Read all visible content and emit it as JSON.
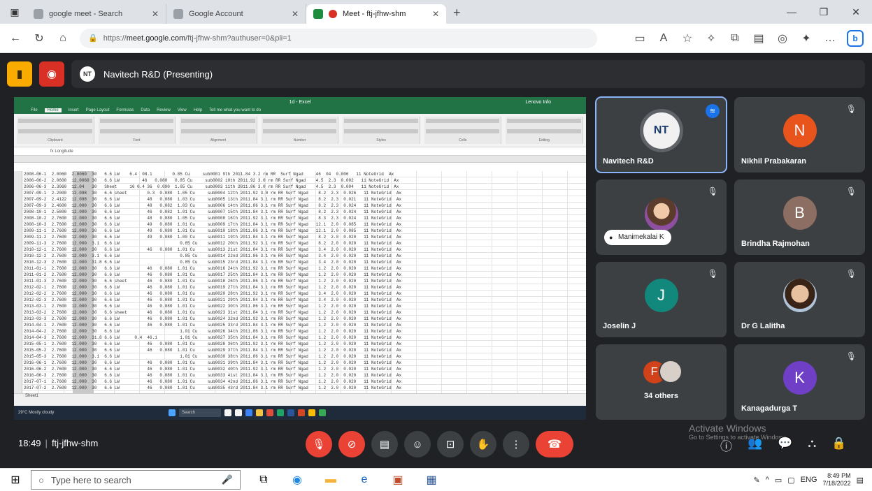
{
  "browser": {
    "tabs": [
      {
        "title": "google meet - Search",
        "active": false
      },
      {
        "title": "Google Account",
        "active": false
      },
      {
        "title": "Meet - ftj-jfhw-shm",
        "active": true
      }
    ],
    "url_prefix": "https://",
    "url_host": "meet.google.com",
    "url_path": "/ftj-jfhw-shm?authuser=0&pli=1",
    "profile_letter": "b"
  },
  "meet": {
    "presenting_label": "Navitech R&D (Presenting)",
    "presenter_initials": "NT",
    "meeting_time": "18:49",
    "meeting_code": "ftj-jfhw-shm",
    "activate_title": "Activate Windows",
    "activate_sub": "Go to Settings to activate Windows."
  },
  "spreadsheet": {
    "title": "1d - Excel",
    "account": "Lenovo Info",
    "menu": [
      "File",
      "Home",
      "Insert",
      "Page Layout",
      "Formulas",
      "Data",
      "Review",
      "View",
      "Help",
      "Tell me what you want to do"
    ],
    "ribbon_groups": [
      "Clipboard",
      "Font",
      "Alignment",
      "Number",
      "Styles",
      "Cells",
      "Editing"
    ],
    "formula": "fx  Longitude",
    "rows": [
      "2008-06-1  2.0060  2.0060  30   6.6 LW    6.4  08.1        0.85 Cu     sub0001 9th 2011.84 3.2 rm RR  Surf Ngad     46  04  0.006   11 NoteGrid  Ax",
      "2006-06-2  2.0600  12.0060 30   6.6 LW         46   0.080   0.85 Cu     sub0002 10th 2011.92 3.0 rm RR Surf Ngad    4.5  2.3  0.002   11 NoteGrid  Ax",
      "2006-06-3  2.3060  12.04   30   Sheet     16 0.4 36  0.090  1.05 Cu     sub0003 11th 2011.86 3.0 rm RR Surf Ngad    4.5  2.3  0.004   11 NoteGrid  Ax",
      "2007-09-1  2.2000  12.098  30   6.6 sheet        0.3  0.080  1.05 Cu     sub0004 12th 2011.92 3.0 rm RR Surf Ngad    8.2  2.3  0.026   11 NoteGrid  Ax",
      "2007-09-2  2.4122  12.098  30   6.6 LW           48   0.080  1.03 Cu     sub0005 13th 2011.84 3.1 rm RR Surf Ngad    8.2  2.3  0.021   11 NoteGrid  Ax",
      "2007-09-3  2.4600  12.000  30   6.6 LW           48   0.082  1.03 Cu     sub0006 14th 2011.86 3.1 rm RR Surf Ngad    8.2  2.3  0.024   11 NoteGrid  Ax",
      "2008-10-1  2.5800  12.000  30   6.6 LW           46   0.082  1.01 Cu     sub0007 15th 2011.84 3.1 rm RR Surf Ngad    8.2  2.3  0.024   11 NoteGrid  Ax",
      "2008-10-2  2.7600  12.000  30   6.6 LW           48   0.080  1.05 Cu     sub0008 16th 2011.92 3.1 rm RR Surf Ngad    8.3  2.3  0.024   11 NoteGrid  Ax",
      "2008-10-3  2.7600  12.000  30   6.6 LW           49   0.080  1.01 Cu     sub0009 17th 2011.84 3.1 rm RR Surf Ngad   12.1  2.0  0.085   11 NoteGrid  Ax",
      "2009-11-1  2.7600  12.000  30   6.6 LW           49   0.080  1.01 Cu     sub0010 18th 2011.86 3.1 rm RR Surf Ngad   12.1  2.0  0.085   11 NoteGrid  Ax",
      "2009-11-2  2.7600  12.000  30   6.6 LW           49   0.080  1.00 Cu     sub0011 19th 2011.84 3.1 rm RR Surf Ngad    8.2  2.0  0.020   11 NoteGrid  Ax",
      "2009-11-3  2.7600  12.000  3.1  6.6 LW                        0.85 Cu    sub0012 20th 2011.92 3.1 rm RR Surf Ngad    8.2  2.0  0.020   11 NoteGrid  Ax",
      "2010-12-1  2.7600  12.000  30   6.6 LW           46   0.080  1.01 Cu     sub0013 21st 2011.84 3.1 rm RR Surf Ngad    3.4  2.0  0.020   11 NoteGrid  Ax",
      "2010-12-2  2.7600  12.000  3.1  6.6 LW                        0.85 Cu    sub0014 22nd 2011.86 3.1 rm RR Surf Ngad    3.4  2.0  0.020   11 NoteGrid  Ax",
      "2010-12-3  2.7600  12.000  31.8 6.6 LW                        0.85 Cu    sub0015 23rd 2011.84 3.1 rm RR Surf Ngad    3.4  2.0  0.020   11 NoteGrid  Ax",
      "2011-01-1  2.7600  12.000  30   6.6 LW           46   0.080  1.01 Cu     sub0016 24th 2011.92 3.1 rm RR Surf Ngad    1.2  2.0  0.020   11 NoteGrid  Ax",
      "2011-01-2  2.7600  12.000  30   6.6 LW           46   0.080  1.01 Cu     sub0017 25th 2011.84 3.1 rm RR Surf Ngad    1.2  2.0  0.020   11 NoteGrid  Ax",
      "2011-01-3  2.7600  12.000  30   6.6 sheet        46   0.080  1.01 Cu     sub0018 26th 2011.86 3.1 rm RR Surf Ngad    1.2  2.0  0.020   11 NoteGrid  Ax",
      "2012-02-1  2.7600  12.000  30   6.6 LW           46   0.080  1.01 Cu     sub0019 27th 2011.84 3.1 rm RR Surf Ngad    1.2  2.0  0.020   11 NoteGrid  Ax",
      "2012-02-2  2.7600  12.000  30   6.6 LW           46   0.080  1.01 Cu     sub0020 28th 2011.92 3.1 rm RR Surf Ngad    3.4  2.0  0.020   11 NoteGrid  Ax",
      "2012-02-3  2.7600  12.000  30   6.6 LW           46   0.080  1.01 Cu     sub0021 29th 2011.84 3.1 rm RR Surf Ngad    3.4  2.0  0.020   11 NoteGrid  Ax",
      "2013-03-1  2.7600  12.000  30   6.6 LW           46   0.080  1.01 Cu     sub0022 30th 2011.86 3.1 rm RR Surf Ngad    1.2  2.0  0.020   11 NoteGrid  Ax",
      "2013-03-2  2.7600  12.000  30   6.6 sheet        46   0.080  1.01 Cu     sub0023 31st 2011.84 3.1 rm RR Surf Ngad    1.2  2.0  0.020   11 NoteGrid  Ax",
      "2013-03-3  2.7600  12.000  30   6.6 LW           46   0.080  1.01 Cu     sub0024 32nd 2011.92 3.1 rm RR Surf Ngad    1.2  2.0  0.020   11 NoteGrid  Ax",
      "2014-04-1  2.7600  12.000  30   6.6 LW           46   0.080  1.01 Cu     sub0025 33rd 2011.84 3.1 rm RR Surf Ngad    1.2  2.0  0.020   11 NoteGrid  Ax",
      "2014-04-2  2.7600  12.000  30   6.6 LW                        1.01 Cu    sub0026 34th 2011.86 3.1 rm RR Surf Ngad    1.2  2.0  0.020   11 NoteGrid  Ax",
      "2014-04-3  2.7600  12.000  31.8 6.6 LW      0.4  46.1         1.01 Cu    sub0027 35th 2011.84 3.1 rm RR Surf Ngad    1.2  2.0  0.020   11 NoteGrid  Ax",
      "2015-05-1  2.7600  12.000  30   6.6 LW           46   0.080  1.01 Cu     sub0028 36th 2011.92 3.1 rm RR Surf Ngad    1.2  2.0  0.020   11 NoteGrid  Ax",
      "2015-05-2  2.7600  12.000  30   6.6 LW           46   0.080  1.01 Cu     sub0029 37th 2011.84 3.1 rm RR Surf Ngad    1.2  2.0  0.020   11 NoteGrid  Ax",
      "2015-05-3  2.7600  12.000  3.1  6.6 LW                        1.01 Cu    sub0030 38th 2011.86 3.1 rm RR Surf Ngad    1.2  2.0  0.020   11 NoteGrid  Ax",
      "2016-06-1  2.7600  12.000  30   6.6 LW           46   0.080  1.01 Cu     sub0031 39th 2011.84 3.1 rm RR Surf Ngad    1.2  2.0  0.020   11 NoteGrid  Ax",
      "2016-06-2  2.7600  12.000  30   6.6 LW           46   0.080  1.01 Cu     sub0032 40th 2011.92 3.1 rm RR Surf Ngad    1.2  2.0  0.020   11 NoteGrid  Ax",
      "2016-06-3  2.7600  12.000  30   6.6 LW           46   0.080  1.01 Cu     sub0033 41st 2011.84 3.1 rm RR Surf Ngad    1.2  2.0  0.020   11 NoteGrid  Ax",
      "2017-07-1  2.7600  12.000  30   6.6 LW           46   0.080  1.01 Cu     sub0034 42nd 2011.86 3.1 rm RR Surf Ngad    1.2  2.0  0.020   11 NoteGrid  Ax",
      "2017-07-2  2.7600  12.000  30   6.6 LW           46   0.080  1.01 Cu     sub0035 43rd 2011.84 3.1 rm RR Surf Ngad    1.2  2.0  0.020   11 NoteGrid  Ax"
    ],
    "sheet_tab": "Sheet1",
    "taskbar_weather": "29°C  Mostly cloudy",
    "taskbar_search": "Search"
  },
  "participants": [
    {
      "name": "Navitech R&D",
      "initial": "NT",
      "color": "#f1f1f1",
      "speaking": true
    },
    {
      "name": "Nikhil Prabakaran",
      "initial": "N",
      "color": "#e8541c",
      "speaking": false
    },
    {
      "name": "Manimekalai K",
      "initial": "",
      "color": "",
      "speaking": false
    },
    {
      "name": "Brindha Rajmohan",
      "initial": "B",
      "color": "#8d6e63",
      "speaking": false
    },
    {
      "name": "Joselin J",
      "initial": "J",
      "color": "#12877b",
      "speaking": false
    },
    {
      "name": "Dr G Lalitha",
      "initial": "",
      "color": "",
      "speaking": false
    },
    {
      "name": "34 others",
      "initial": "F",
      "color": "#d2421a",
      "speaking": false
    },
    {
      "name": "Kanagadurga T",
      "initial": "K",
      "color": "#6f3fc6",
      "speaking": false
    }
  ],
  "windows": {
    "search_placeholder": "Type here to search",
    "time": "8:49 PM",
    "date": "7/18/2022",
    "lang": "ENG"
  }
}
